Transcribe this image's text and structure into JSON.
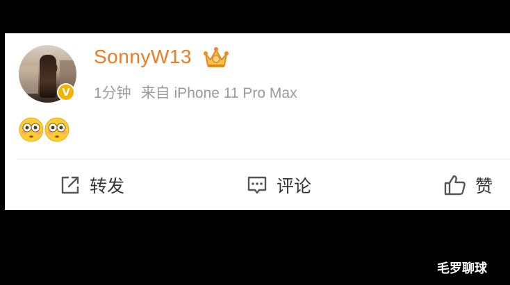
{
  "post": {
    "username": "SonnyW13",
    "time": "1分钟",
    "source": "来自 iPhone 11 Pro Max",
    "verified_badge": "V",
    "content_emojis": [
      "flushed-face-emoji",
      "flushed-face-emoji"
    ]
  },
  "actions": {
    "repost_label": "转发",
    "comment_label": "评论",
    "like_label": "赞"
  },
  "watermark": "毛罗聊球",
  "colors": {
    "username": "#f07a20",
    "meta": "#9a9a9a",
    "badge": "#f2b400",
    "background": "#000000",
    "card": "#ffffff"
  }
}
